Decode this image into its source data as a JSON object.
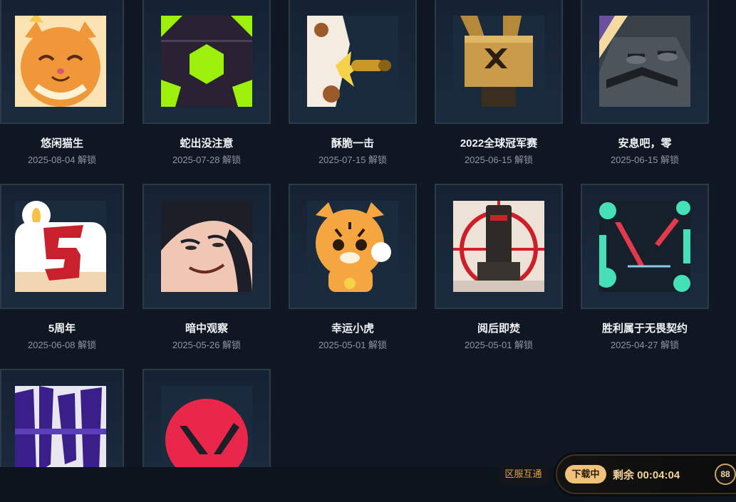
{
  "sprays": [
    {
      "name": "悠闲猫生",
      "date": "2025-08-04 解锁",
      "icon": "relaxed-cat-spray"
    },
    {
      "name": "蛇出没注意",
      "date": "2025-07-28 解锁",
      "icon": "green-hexagon-spray"
    },
    {
      "name": "酥脆一击",
      "date": "2025-07-15 解锁",
      "icon": "bullet-burst-spray"
    },
    {
      "name": "2022全球冠军赛",
      "date": "2025-06-15 解锁",
      "icon": "champions-trophy-spray"
    },
    {
      "name": "安息吧，零",
      "date": "2025-06-15 解锁",
      "icon": "rest-robot-spray"
    },
    {
      "name": "5周年",
      "date": "2025-06-08 解锁",
      "icon": "birthday-candle-spray"
    },
    {
      "name": "暗中观察",
      "date": "2025-05-26 解锁",
      "icon": "smirk-face-spray"
    },
    {
      "name": "幸运小虎",
      "date": "2025-05-01 解锁",
      "icon": "lucky-tiger-spray"
    },
    {
      "name": "阅后即焚",
      "date": "2025-05-01 解锁",
      "icon": "target-pillar-spray"
    },
    {
      "name": "胜利属于无畏契约",
      "date": "2025-04-27 解锁",
      "icon": "valorant-splash-spray"
    },
    {
      "name": "",
      "date": "",
      "icon": "graffiti-text-spray"
    },
    {
      "name": "",
      "date": "",
      "icon": "valorant-logo-spray"
    }
  ],
  "footer": {
    "region_label": "区服互通",
    "download_status": "下载中",
    "remaining": "剩余 00:04:04",
    "badge": "88"
  },
  "colors": {
    "background": "#0f1822",
    "card_border": "#2d3a48",
    "accent_gold": "#f0c27a",
    "region_text": "#e5a14b"
  }
}
